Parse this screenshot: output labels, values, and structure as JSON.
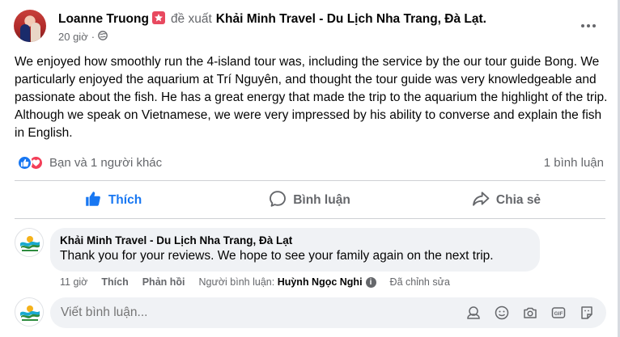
{
  "post": {
    "author": "Loanne Truong",
    "verb": "đề xuất",
    "page_name": "Khải Minh Travel - Du Lịch Nha Trang, Đà Lạt.",
    "time": "20 giờ",
    "privacy_icon": "globe-icon",
    "text": "We enjoyed how smoothly run the 4-island tour was, including the service by the our tour guide Bong. We particularly enjoyed the aquarium at Trí Nguyên, and thought the tour guide was very knowledgeable and passionate about the fish. He has a great energy that made the trip to the aquarium the highlight of the trip. Although we speak on Vietnamese, we were very impressed by his ability to converse and explain the fish in English."
  },
  "reactions": {
    "types": [
      "like",
      "love"
    ],
    "summary": "Bạn và 1 người khác",
    "comment_count": "1 bình luận"
  },
  "actions": {
    "like": "Thích",
    "comment": "Bình luận",
    "share": "Chia sẻ"
  },
  "comment": {
    "author": "Khải Minh Travel - Du Lịch Nha Trang, Đà Lạt",
    "text": "Thank you for your reviews. We hope to see your family again on the next trip.",
    "time": "11 giờ",
    "like": "Thích",
    "reply": "Phản hồi",
    "replier_label": "Người bình luận:",
    "replier_name": "Huỳnh Ngọc Nghi",
    "edited": "Đã chỉnh sửa"
  },
  "composer": {
    "placeholder": "Viết bình luận..."
  },
  "colors": {
    "accent": "#1877f2",
    "love": "#f33e58",
    "muted_text": "#65676b",
    "bubble_bg": "#f0f2f5"
  }
}
